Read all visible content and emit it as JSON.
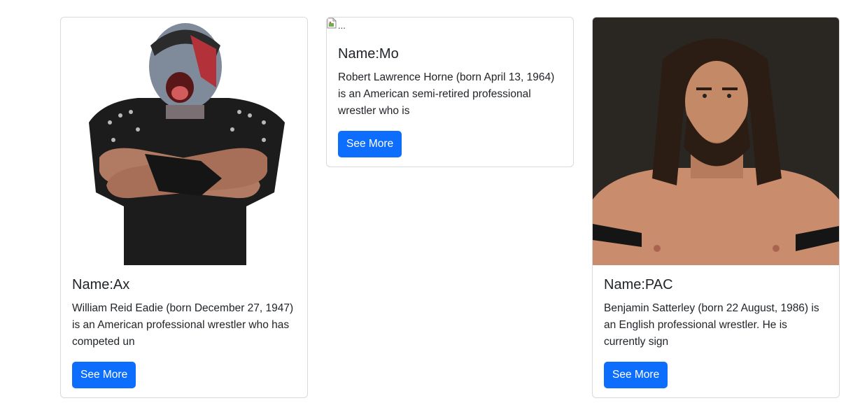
{
  "cards": [
    {
      "name_prefix": "Name:",
      "name": "Ax",
      "description": "William Reid Eadie (born December 27, 1947) is an American professional wrestler who has competed un",
      "button_label": "See More"
    },
    {
      "image_alt": "...",
      "name_prefix": "Name:",
      "name": "Mo",
      "description": "Robert Lawrence Horne (born April 13, 1964) is an American semi-retired professional wrestler who is",
      "button_label": "See More"
    },
    {
      "name_prefix": "Name:",
      "name": "PAC",
      "description": "Benjamin Satterley (born 22 August, 1986) is an English professional wrestler. He is currently sign",
      "button_label": "See More"
    }
  ],
  "colors": {
    "button_bg": "#0d6efd",
    "card_border": "#d9d9d9"
  }
}
